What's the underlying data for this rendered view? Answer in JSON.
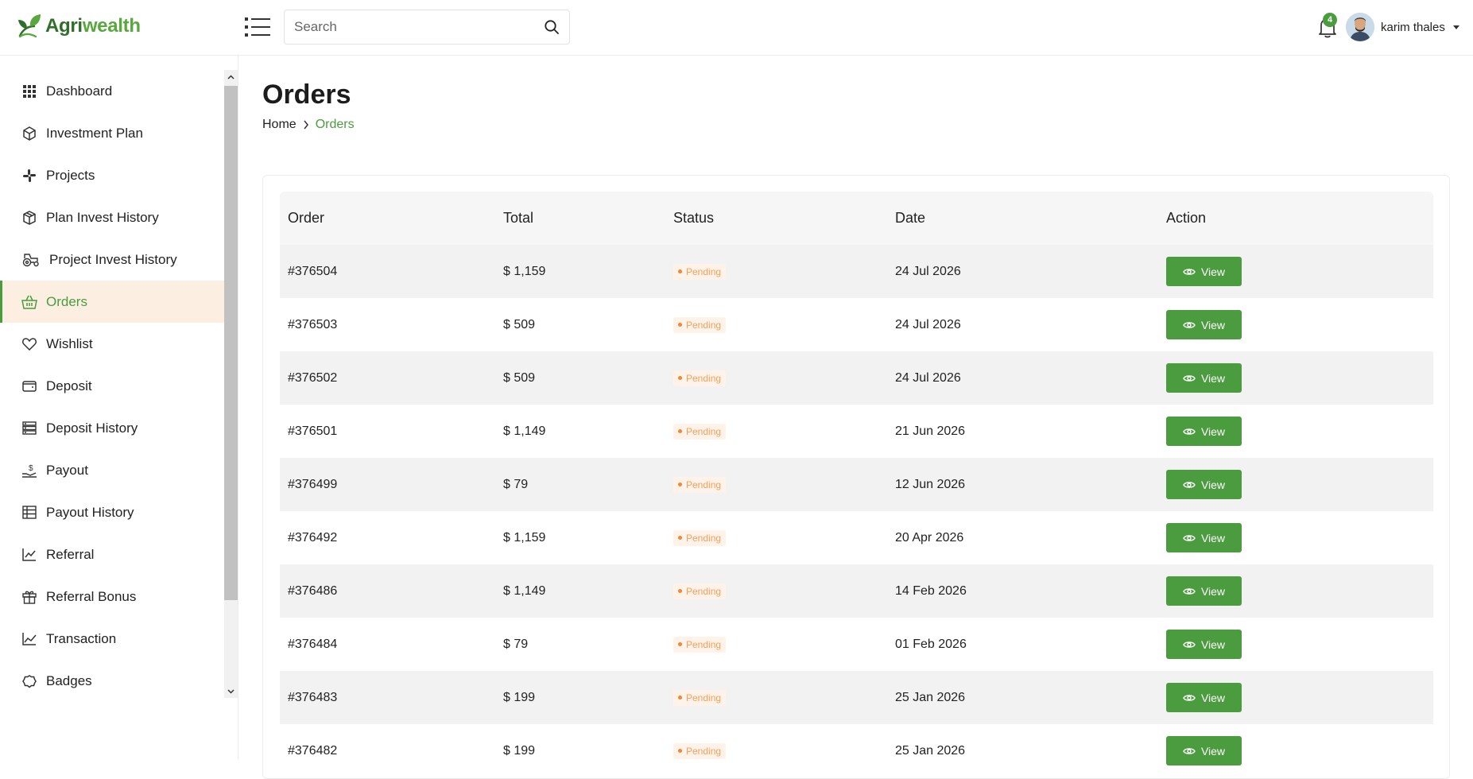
{
  "brand": {
    "part1": "Agri",
    "part2": "wealth",
    "logo_icon": "leaf-logo-icon"
  },
  "header": {
    "search_placeholder": "Search",
    "notification_count": "4",
    "user_name": "karim thales"
  },
  "sidebar": {
    "items": [
      {
        "label": "Dashboard",
        "icon": "grid-icon"
      },
      {
        "label": "Investment Plan",
        "icon": "cube-icon"
      },
      {
        "label": "Projects",
        "icon": "slack-icon"
      },
      {
        "label": "Plan Invest History",
        "icon": "box-icon"
      },
      {
        "label": "Project Invest History",
        "icon": "tractor-icon"
      },
      {
        "label": "Orders",
        "icon": "basket-icon",
        "active": true
      },
      {
        "label": "Wishlist",
        "icon": "heart-icon"
      },
      {
        "label": "Deposit",
        "icon": "wallet-icon"
      },
      {
        "label": "Deposit History",
        "icon": "server-icon"
      },
      {
        "label": "Payout",
        "icon": "hand-coin-icon"
      },
      {
        "label": "Payout History",
        "icon": "table-icon"
      },
      {
        "label": "Referral",
        "icon": "line-chart-icon"
      },
      {
        "label": "Referral Bonus",
        "icon": "gift-icon"
      },
      {
        "label": "Transaction",
        "icon": "trend-icon"
      },
      {
        "label": "Badges",
        "icon": "badge-icon"
      }
    ]
  },
  "page": {
    "title": "Orders",
    "breadcrumb": {
      "home": "Home",
      "current": "Orders"
    }
  },
  "table": {
    "headers": {
      "order": "Order",
      "total": "Total",
      "status": "Status",
      "date": "Date",
      "action": "Action"
    },
    "action_label": "View",
    "rows": [
      {
        "order": "#376504",
        "total": "$ 1,159",
        "status": "Pending",
        "date": "24 Jul 2026"
      },
      {
        "order": "#376503",
        "total": "$ 509",
        "status": "Pending",
        "date": "24 Jul 2026"
      },
      {
        "order": "#376502",
        "total": "$ 509",
        "status": "Pending",
        "date": "24 Jul 2026"
      },
      {
        "order": "#376501",
        "total": "$ 1,149",
        "status": "Pending",
        "date": "21 Jun 2026"
      },
      {
        "order": "#376499",
        "total": "$ 79",
        "status": "Pending",
        "date": "12 Jun 2026"
      },
      {
        "order": "#376492",
        "total": "$ 1,159",
        "status": "Pending",
        "date": "20 Apr 2026"
      },
      {
        "order": "#376486",
        "total": "$ 1,149",
        "status": "Pending",
        "date": "14 Feb 2026"
      },
      {
        "order": "#376484",
        "total": "$ 79",
        "status": "Pending",
        "date": "01 Feb 2026"
      },
      {
        "order": "#376483",
        "total": "$ 199",
        "status": "Pending",
        "date": "25 Jan 2026"
      },
      {
        "order": "#376482",
        "total": "$ 199",
        "status": "Pending",
        "date": "25 Jan 2026"
      }
    ]
  },
  "colors": {
    "accent": "#4a9c3e",
    "active_bg": "#fdeee2",
    "pending": "#f0a25e"
  }
}
